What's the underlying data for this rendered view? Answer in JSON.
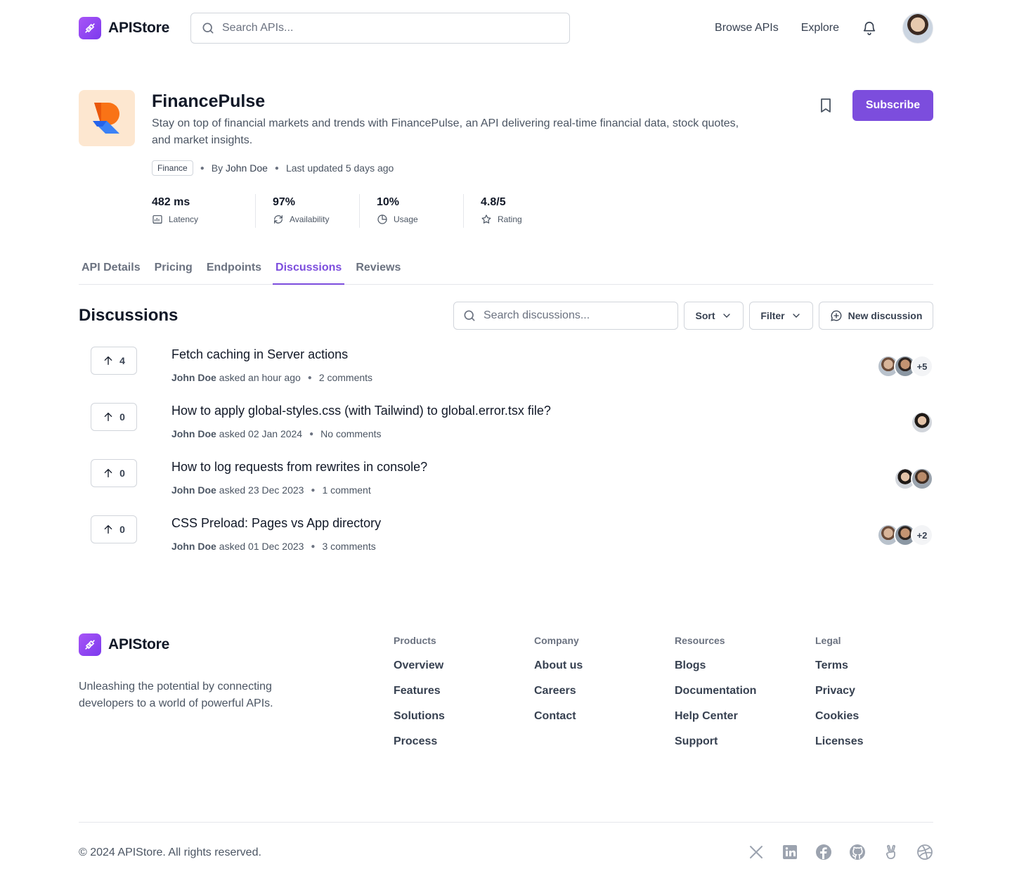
{
  "header": {
    "brand": "APIStore",
    "search_placeholder": "Search APIs...",
    "nav": [
      "Browse APIs",
      "Explore"
    ]
  },
  "product": {
    "name": "FinancePulse",
    "description": "Stay on top of financial markets and trends with FinancePulse, an API delivering real-time financial data, stock quotes, and market insights.",
    "tag": "Finance",
    "by_prefix": "By",
    "author": "John Doe",
    "updated": "Last updated 5 days ago",
    "subscribe_label": "Subscribe",
    "stats": [
      {
        "value": "482 ms",
        "label": "Latency",
        "icon": "latency-icon"
      },
      {
        "value": "97%",
        "label": "Availability",
        "icon": "availability-icon"
      },
      {
        "value": "10%",
        "label": "Usage",
        "icon": "usage-icon"
      },
      {
        "value": "4.8/5",
        "label": "Rating",
        "icon": "star-icon"
      }
    ]
  },
  "tabs": [
    "API Details",
    "Pricing",
    "Endpoints",
    "Discussions",
    "Reviews"
  ],
  "active_tab": "Discussions",
  "discussions": {
    "title": "Discussions",
    "search_placeholder": "Search discussions...",
    "sort_label": "Sort",
    "filter_label": "Filter",
    "new_label": "New discussion",
    "items": [
      {
        "votes": "4",
        "question": "Fetch caching in Server actions",
        "author": "John Doe",
        "asked": "asked an hour ago",
        "comments": "2 comments",
        "extra": "+5"
      },
      {
        "votes": "0",
        "question": "How to apply global-styles.css (with Tailwind) to global.error.tsx file?",
        "author": "John Doe",
        "asked": "asked 02 Jan 2024",
        "comments": "No comments",
        "extra": ""
      },
      {
        "votes": "0",
        "question": "How to log requests from rewrites in console?",
        "author": "John Doe",
        "asked": "asked 23 Dec 2023",
        "comments": "1 comment",
        "extra": ""
      },
      {
        "votes": "0",
        "question": "CSS Preload: Pages vs App directory",
        "author": "John Doe",
        "asked": "asked 01 Dec 2023",
        "comments": "3 comments",
        "extra": "+2"
      }
    ]
  },
  "footer": {
    "brand": "APIStore",
    "tagline": "Unleashing the potential by connecting developers to a world of powerful APIs.",
    "columns": [
      {
        "title": "Products",
        "links": [
          "Overview",
          "Features",
          "Solutions",
          "Process"
        ]
      },
      {
        "title": "Company",
        "links": [
          "About us",
          "Careers",
          "Contact"
        ]
      },
      {
        "title": "Resources",
        "links": [
          "Blogs",
          "Documentation",
          "Help Center",
          "Support"
        ]
      },
      {
        "title": "Legal",
        "links": [
          "Terms",
          "Privacy",
          "Cookies",
          "Licenses"
        ]
      }
    ],
    "copyright": "© 2024 APIStore. All rights reserved.",
    "socials": [
      "x-icon",
      "linkedin-icon",
      "facebook-icon",
      "github-icon",
      "angellist-icon",
      "dribbble-icon"
    ]
  },
  "colors": {
    "accent": "#7c4ddd",
    "text": "#111827",
    "muted": "#4b5563",
    "border": "#d1d5db"
  }
}
